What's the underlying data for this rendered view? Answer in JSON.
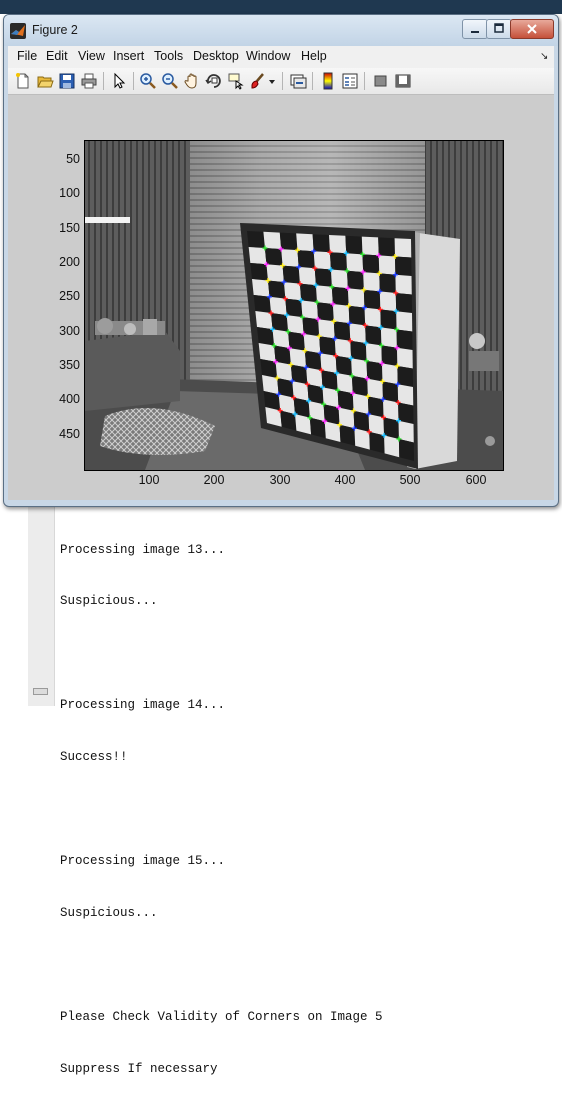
{
  "window": {
    "title": "Figure 2",
    "menu": [
      "File",
      "Edit",
      "View",
      "Insert",
      "Tools",
      "Desktop",
      "Window",
      "Help"
    ],
    "menu_overflow": "↘"
  },
  "toolbar": {
    "icons": [
      "new-figure-icon",
      "open-file-icon",
      "save-icon",
      "print-icon",
      "pointer-icon",
      "zoom-in-icon",
      "zoom-out-icon",
      "pan-icon",
      "rotate-3d-icon",
      "data-cursor-icon",
      "brush-icon",
      "link-plot-icon",
      "colorbar-icon",
      "legend-icon",
      "hide-plot-tools-icon",
      "show-plot-tools-icon"
    ]
  },
  "axes": {
    "yticks": [
      "50",
      "100",
      "150",
      "200",
      "250",
      "300",
      "350",
      "400",
      "450"
    ],
    "xticks": [
      "100",
      "200",
      "300",
      "400",
      "500",
      "600"
    ]
  },
  "console": {
    "lines": [
      "Processing image 13...",
      "Suspicious...",
      "",
      "Processing image 14...",
      "Success!!",
      "",
      "Processing image 15...",
      "Suspicious...",
      "",
      "Please Check Validity of Corners on Image 5",
      "Suppress If necessary"
    ]
  }
}
